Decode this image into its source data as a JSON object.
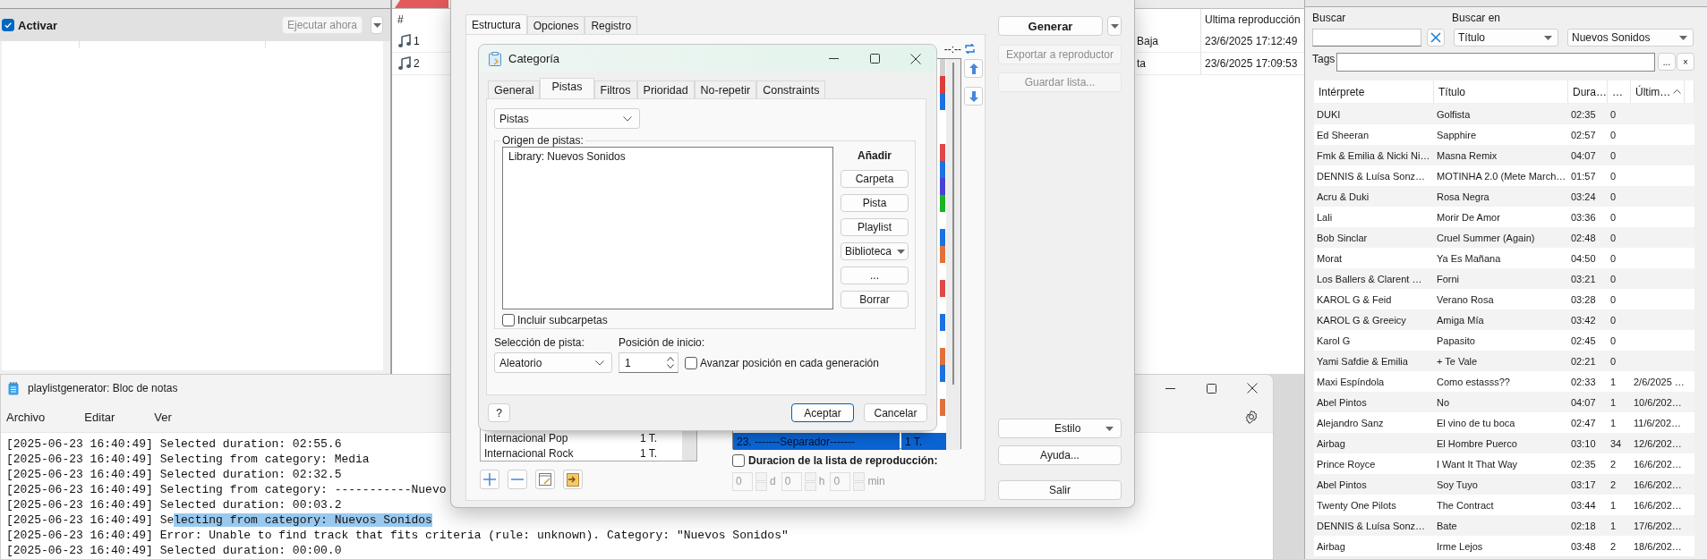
{
  "scheduler_panel": {
    "activate": {
      "label": "Activar",
      "checked": true
    },
    "run_now": {
      "label": "Ejecutar ahora",
      "disabled": true
    }
  },
  "playlist_panel": {
    "columns": [
      "#",
      "Ultima reproducción"
    ],
    "rows": [
      {
        "number": "1",
        "column_2": "Baja",
        "last_played": "23/6/2025 17:12:49"
      },
      {
        "number": "2",
        "column_2": "ta",
        "last_played": "23/6/2025 17:09:53"
      }
    ]
  },
  "search_panel": {
    "search_label": "Buscar",
    "search_in_label": "Buscar en",
    "search_in": "Título",
    "library": "Nuevos Sonidos",
    "tags_label": "Tags",
    "tags_browse": "...",
    "tags_clear": "×",
    "columns": [
      {
        "label": "Intérprete",
        "sorted": false
      },
      {
        "label": "Título",
        "sorted": false
      },
      {
        "label": "Dura…",
        "sorted": false
      },
      {
        "label": "…",
        "sorted": false
      },
      {
        "label": "Últim…",
        "sorted": true
      }
    ],
    "rows": [
      {
        "artist": "DUKI",
        "title": "Golfista",
        "duration": "02:35",
        "plays": "0"
      },
      {
        "artist": "Ed Sheeran",
        "title": "Sapphire",
        "duration": "02:57",
        "plays": "0"
      },
      {
        "artist": "Fmk & Emilia & Nicki Ni…",
        "title": "Masna Remix",
        "duration": "04:07",
        "plays": "0"
      },
      {
        "artist": "DENNIS & Luísa Sonz…",
        "title": "MOTINHA 2.0 (Mete March…",
        "duration": "01:57",
        "plays": "0"
      },
      {
        "artist": "Acru & Duki",
        "title": "Rosa Negra",
        "duration": "03:24",
        "plays": "0"
      },
      {
        "artist": "Lali",
        "title": "Morir De Amor",
        "duration": "03:36",
        "plays": "0"
      },
      {
        "artist": "Bob Sinclar",
        "title": "Cruel Summer (Again)",
        "duration": "02:48",
        "plays": "0"
      },
      {
        "artist": "Morat",
        "title": "Ya Es Mañana",
        "duration": "04:50",
        "plays": "0"
      },
      {
        "artist": "Los Ballers & Clarent …",
        "title": "Forni",
        "duration": "03:21",
        "plays": "0"
      },
      {
        "artist": "KAROL G & Feid",
        "title": "Verano Rosa",
        "duration": "03:28",
        "plays": "0"
      },
      {
        "artist": "KAROL G & Greeicy",
        "title": "Amiga Mía",
        "duration": "03:42",
        "plays": "0"
      },
      {
        "artist": "Karol G",
        "title": "Papasito",
        "duration": "02:45",
        "plays": "0"
      },
      {
        "artist": "Yami Safdie & Emilia",
        "title": "+ Te Vale",
        "duration": "02:21",
        "plays": "0"
      },
      {
        "artist": "Maxi Espíndola",
        "title": "Como estasss??",
        "duration": "02:33",
        "plays": "1",
        "last_played": "2/6/2025 …"
      },
      {
        "artist": "Abel Pintos",
        "title": "No",
        "duration": "04:07",
        "plays": "1",
        "last_played": "10/6/202…"
      },
      {
        "artist": "Alejandro Sanz",
        "title": "El vino de tu boca",
        "duration": "02:47",
        "plays": "1",
        "last_played": "11/6/202…"
      },
      {
        "artist": "Airbag",
        "title": "El Hombre Puerco",
        "duration": "03:10",
        "plays": "34",
        "last_played": "12/6/202…"
      },
      {
        "artist": "Prince Royce",
        "title": "I Want It That Way",
        "duration": "02:35",
        "plays": "2",
        "last_played": "16/6/202…"
      },
      {
        "artist": "Abel Pintos",
        "title": "Soy Tuyo",
        "duration": "03:17",
        "plays": "2",
        "last_played": "16/6/202…"
      },
      {
        "artist": "Twenty One Pilots",
        "title": "The Contract",
        "duration": "03:44",
        "plays": "1",
        "last_played": "16/6/202…"
      },
      {
        "artist": "DENNIS & Luísa Sonz…",
        "title": "Bate",
        "duration": "02:18",
        "plays": "1",
        "last_played": "17/6/202…"
      },
      {
        "artist": "Airbag",
        "title": "Irme Lejos",
        "duration": "03:48",
        "plays": "2",
        "last_played": "18/6/202…"
      }
    ]
  },
  "notepad": {
    "title": "playlistgenerator: Bloc de notas",
    "menu": [
      "Archivo",
      "Editar",
      "Ver"
    ],
    "lines": [
      {
        "text": "[2025-06-23 16:40:49] Selected duration: 02:55.6"
      },
      {
        "text": "[2025-06-23 16:40:49] Selecting from category: Media"
      },
      {
        "text": "[2025-06-23 16:40:49] Selected duration: 02:32.5"
      },
      {
        "text": "[2025-06-23 16:40:49] Selecting from category: -----------Nuevo"
      },
      {
        "text": "[2025-06-23 16:40:49] Selected duration: 00:03.2"
      },
      {
        "text": "[2025-06-23 16:40:49] Se",
        "selected_text": "lecting from category: Nuevos Sonidos"
      },
      {
        "text": "[2025-06-23 16:40:49] Error: Unable to find track that fits criteria (rule: unknown). Category: \"Nuevos Sonidos\""
      },
      {
        "text": "[2025-06-23 16:40:49] Selected duration: 00:00.0"
      }
    ]
  },
  "generator": {
    "tabs": [
      {
        "label": "Estructura",
        "selected": true
      },
      {
        "label": "Opciones",
        "selected": false
      },
      {
        "label": "Registro",
        "selected": false
      }
    ],
    "category_rows": [
      {
        "name": "Internacional Pop",
        "count": "1 T."
      },
      {
        "name": "Internacional Rock",
        "count": "1 T."
      }
    ],
    "total_time": "--:--",
    "structure_markers": [
      {
        "kind": "marked",
        "color": "#d0d0d0"
      },
      {
        "kind": "marked",
        "color": "#e03a3a"
      },
      {
        "kind": "marked",
        "color": "#1a73e0"
      },
      {
        "kind": "plain"
      },
      {
        "kind": "plain"
      },
      {
        "kind": "marked",
        "color": "#e04848"
      },
      {
        "kind": "marked",
        "color": "#1a73e0"
      },
      {
        "kind": "marked",
        "color": "#4b3fd6"
      },
      {
        "kind": "marked",
        "color": "#19b324"
      },
      {
        "kind": "plain"
      },
      {
        "kind": "marked",
        "color": "#1a73e0"
      },
      {
        "kind": "marked",
        "color": "#e0713a"
      },
      {
        "kind": "plain"
      },
      {
        "kind": "marked",
        "color": "#e04848"
      },
      {
        "kind": "plain"
      },
      {
        "kind": "marked",
        "color": "#1a73e0"
      },
      {
        "kind": "plain"
      },
      {
        "kind": "marked",
        "color": "#e0713a"
      },
      {
        "kind": "marked",
        "color": "#1a73e0"
      },
      {
        "kind": "plain"
      },
      {
        "kind": "marked",
        "color": "#e0713a"
      },
      {
        "kind": "plain"
      }
    ],
    "structure_rows": [
      {
        "label": "23. -------Separador-------",
        "count": "1 T.",
        "selected": true
      }
    ],
    "duration": {
      "label": "Duracion de la lista de reproducción:",
      "checked": false,
      "fields": [
        {
          "value": "0",
          "unit": "d"
        },
        {
          "value": "0",
          "unit": "h"
        },
        {
          "value": "0",
          "unit": "min"
        }
      ]
    },
    "actions": [
      {
        "label": "Generar",
        "kind": "split",
        "disabled": false
      },
      {
        "label": "Exportar a reproductor",
        "kind": "button",
        "disabled": true
      },
      {
        "label": "Guardar lista...",
        "kind": "button",
        "disabled": true
      }
    ],
    "bottom_actions": [
      {
        "label": "Estilo",
        "kind": "dropdown"
      },
      {
        "label": "Ayuda...",
        "kind": "button"
      },
      {
        "label": "Salir",
        "kind": "button"
      }
    ]
  },
  "category_dialog": {
    "title": "Categoría",
    "tabs": [
      {
        "label": "General",
        "selected": false
      },
      {
        "label": "Pistas",
        "selected": true
      },
      {
        "label": "Filtros",
        "selected": false
      },
      {
        "label": "Prioridad",
        "selected": false
      },
      {
        "label": "No-repetir",
        "selected": false
      },
      {
        "label": "Constraints",
        "selected": false
      }
    ],
    "source_type": "Pistas",
    "group_label": "Origen de pistas:",
    "sources": [
      "Library: Nuevos Sonidos"
    ],
    "add_label": "Añadir",
    "add_buttons": [
      {
        "label": "Carpeta",
        "kind": "button"
      },
      {
        "label": "Pista",
        "kind": "button"
      },
      {
        "label": "Playlist",
        "kind": "button"
      },
      {
        "label": "Biblioteca",
        "kind": "dropdown"
      },
      {
        "label": "...",
        "kind": "button"
      },
      {
        "label": "Borrar",
        "kind": "button"
      }
    ],
    "include_subfolders": {
      "label": "Incluir subcarpetas",
      "checked": false
    },
    "selection_label": "Selección de pista:",
    "selection": "Aleatorio",
    "start_label": "Posición de inicio:",
    "start": "1",
    "advance": {
      "label": "Avanzar posición en cada generación",
      "checked": false
    },
    "help": "?",
    "ok": "Aceptar",
    "cancel": "Cancelar"
  }
}
